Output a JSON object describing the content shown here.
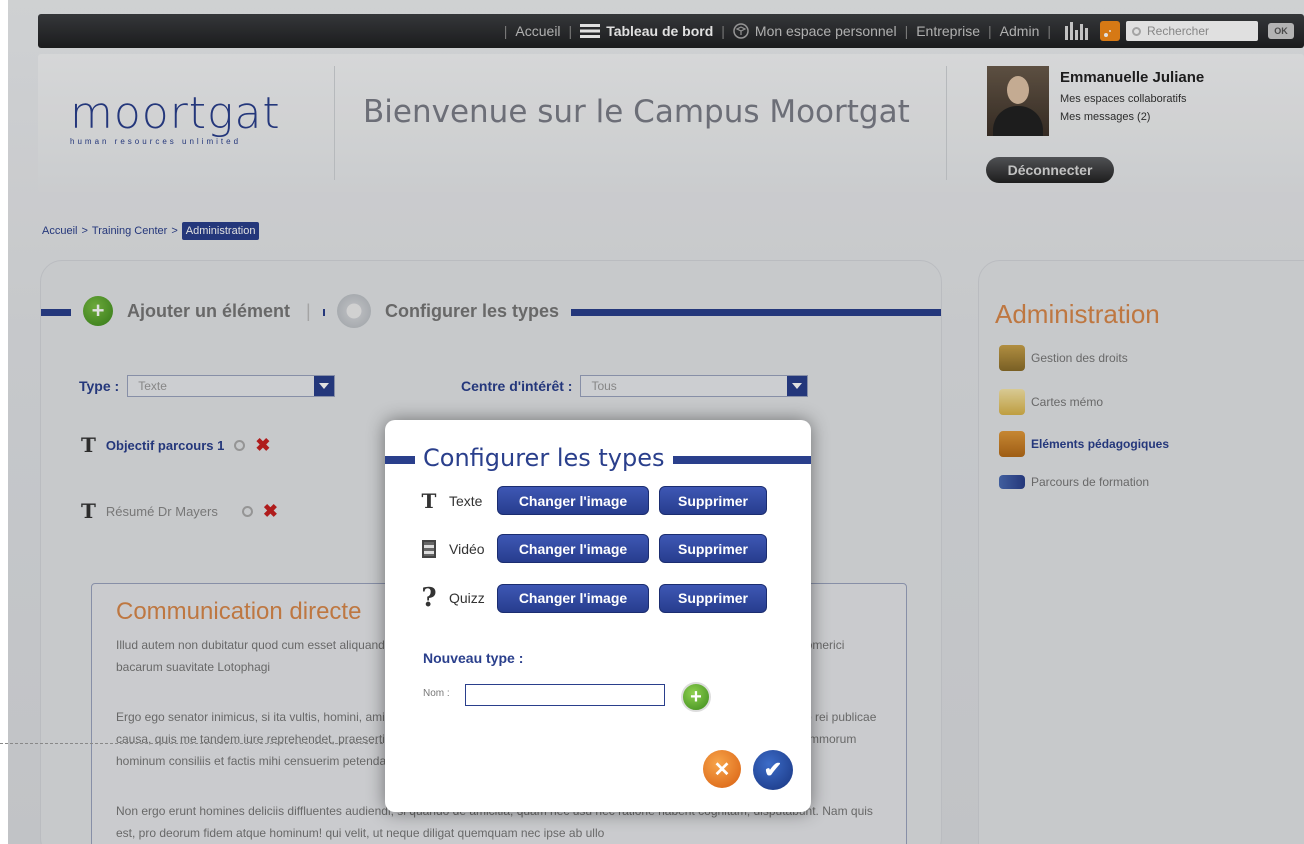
{
  "topbar": {
    "nav": [
      "Accueil",
      "Tableau de bord",
      "Mon espace personnel",
      "Entreprise",
      "Admin"
    ],
    "search_placeholder": "Rechercher",
    "ok_label": "OK"
  },
  "header": {
    "logo_word": "moortgat",
    "logo_tagline": "human resources unlimited",
    "welcome": "Bienvenue sur le Campus Moortgat",
    "user_name": "Emmanuelle Juliane",
    "user_link_spaces": "Mes espaces collaboratifs",
    "user_link_messages": "Mes messages (2)",
    "logout_label": "Déconnecter"
  },
  "breadcrumb": {
    "items": [
      "Accueil",
      "Training Center"
    ],
    "separator": ">",
    "current": "Administration"
  },
  "main": {
    "tab_add": "Ajouter un élément",
    "tab_config": "Configurer les types",
    "filter_type_label": "Type :",
    "filter_type_value": "Texte",
    "filter_interest_label": "Centre d'intérêt :",
    "filter_interest_value": "Tous",
    "elements": [
      "Objectif parcours 1",
      "Résumé Dr Mayers"
    ],
    "content_title": "Communication directe",
    "paragraphs": [
      "Illud autem non dubitatur quod cum esset aliquando virtutum omnium domicilium Roma, ingenuos advenas plerique nobilium, ut Homerici bacarum suavitate Lotophagi",
      "Ergo ego senator inimicus, si ita vultis, homini, amicus esse, sicut semper fui, rei publicae debeo. Quid? si ipsas inimicitias, depono rei publicae causa, quis me tandem iure reprehendet, praesertim cum ego omnium meorum consiliorum atque factorum exempla semper ex summorum hominum consiliis et factis mihi censuerim petenda.",
      "Non ergo erunt homines deliciis diffluentes audiendi, si quando de amicitia, quam nec usu nec ratione habent cognitam, disputabunt. Nam quis est, pro deorum fidem atque hominum! qui velit, ut neque diligat quemquam nec ipse ab ullo"
    ]
  },
  "sidebar": {
    "title": "Administration",
    "items": [
      {
        "label": "Gestion des droits",
        "active": false
      },
      {
        "label": "Cartes mémo",
        "active": false
      },
      {
        "label": "Eléments pédagogiques",
        "active": true
      },
      {
        "label": "Parcours de formation",
        "active": false
      }
    ]
  },
  "modal": {
    "title": "Configurer les types",
    "types": [
      {
        "label": "Texte",
        "icon": "text-t-icon"
      },
      {
        "label": "Vidéo",
        "icon": "film-icon"
      },
      {
        "label": "Quizz",
        "icon": "question-icon"
      }
    ],
    "change_image_label": "Changer l'image",
    "delete_label": "Supprimer",
    "new_type_label": "Nouveau type :",
    "name_label": "Nom :",
    "name_value": ""
  },
  "colors": {
    "brand_blue": "#2a3f8c",
    "accent_orange": "#d9884a",
    "green_plus": "#4f9e26"
  }
}
